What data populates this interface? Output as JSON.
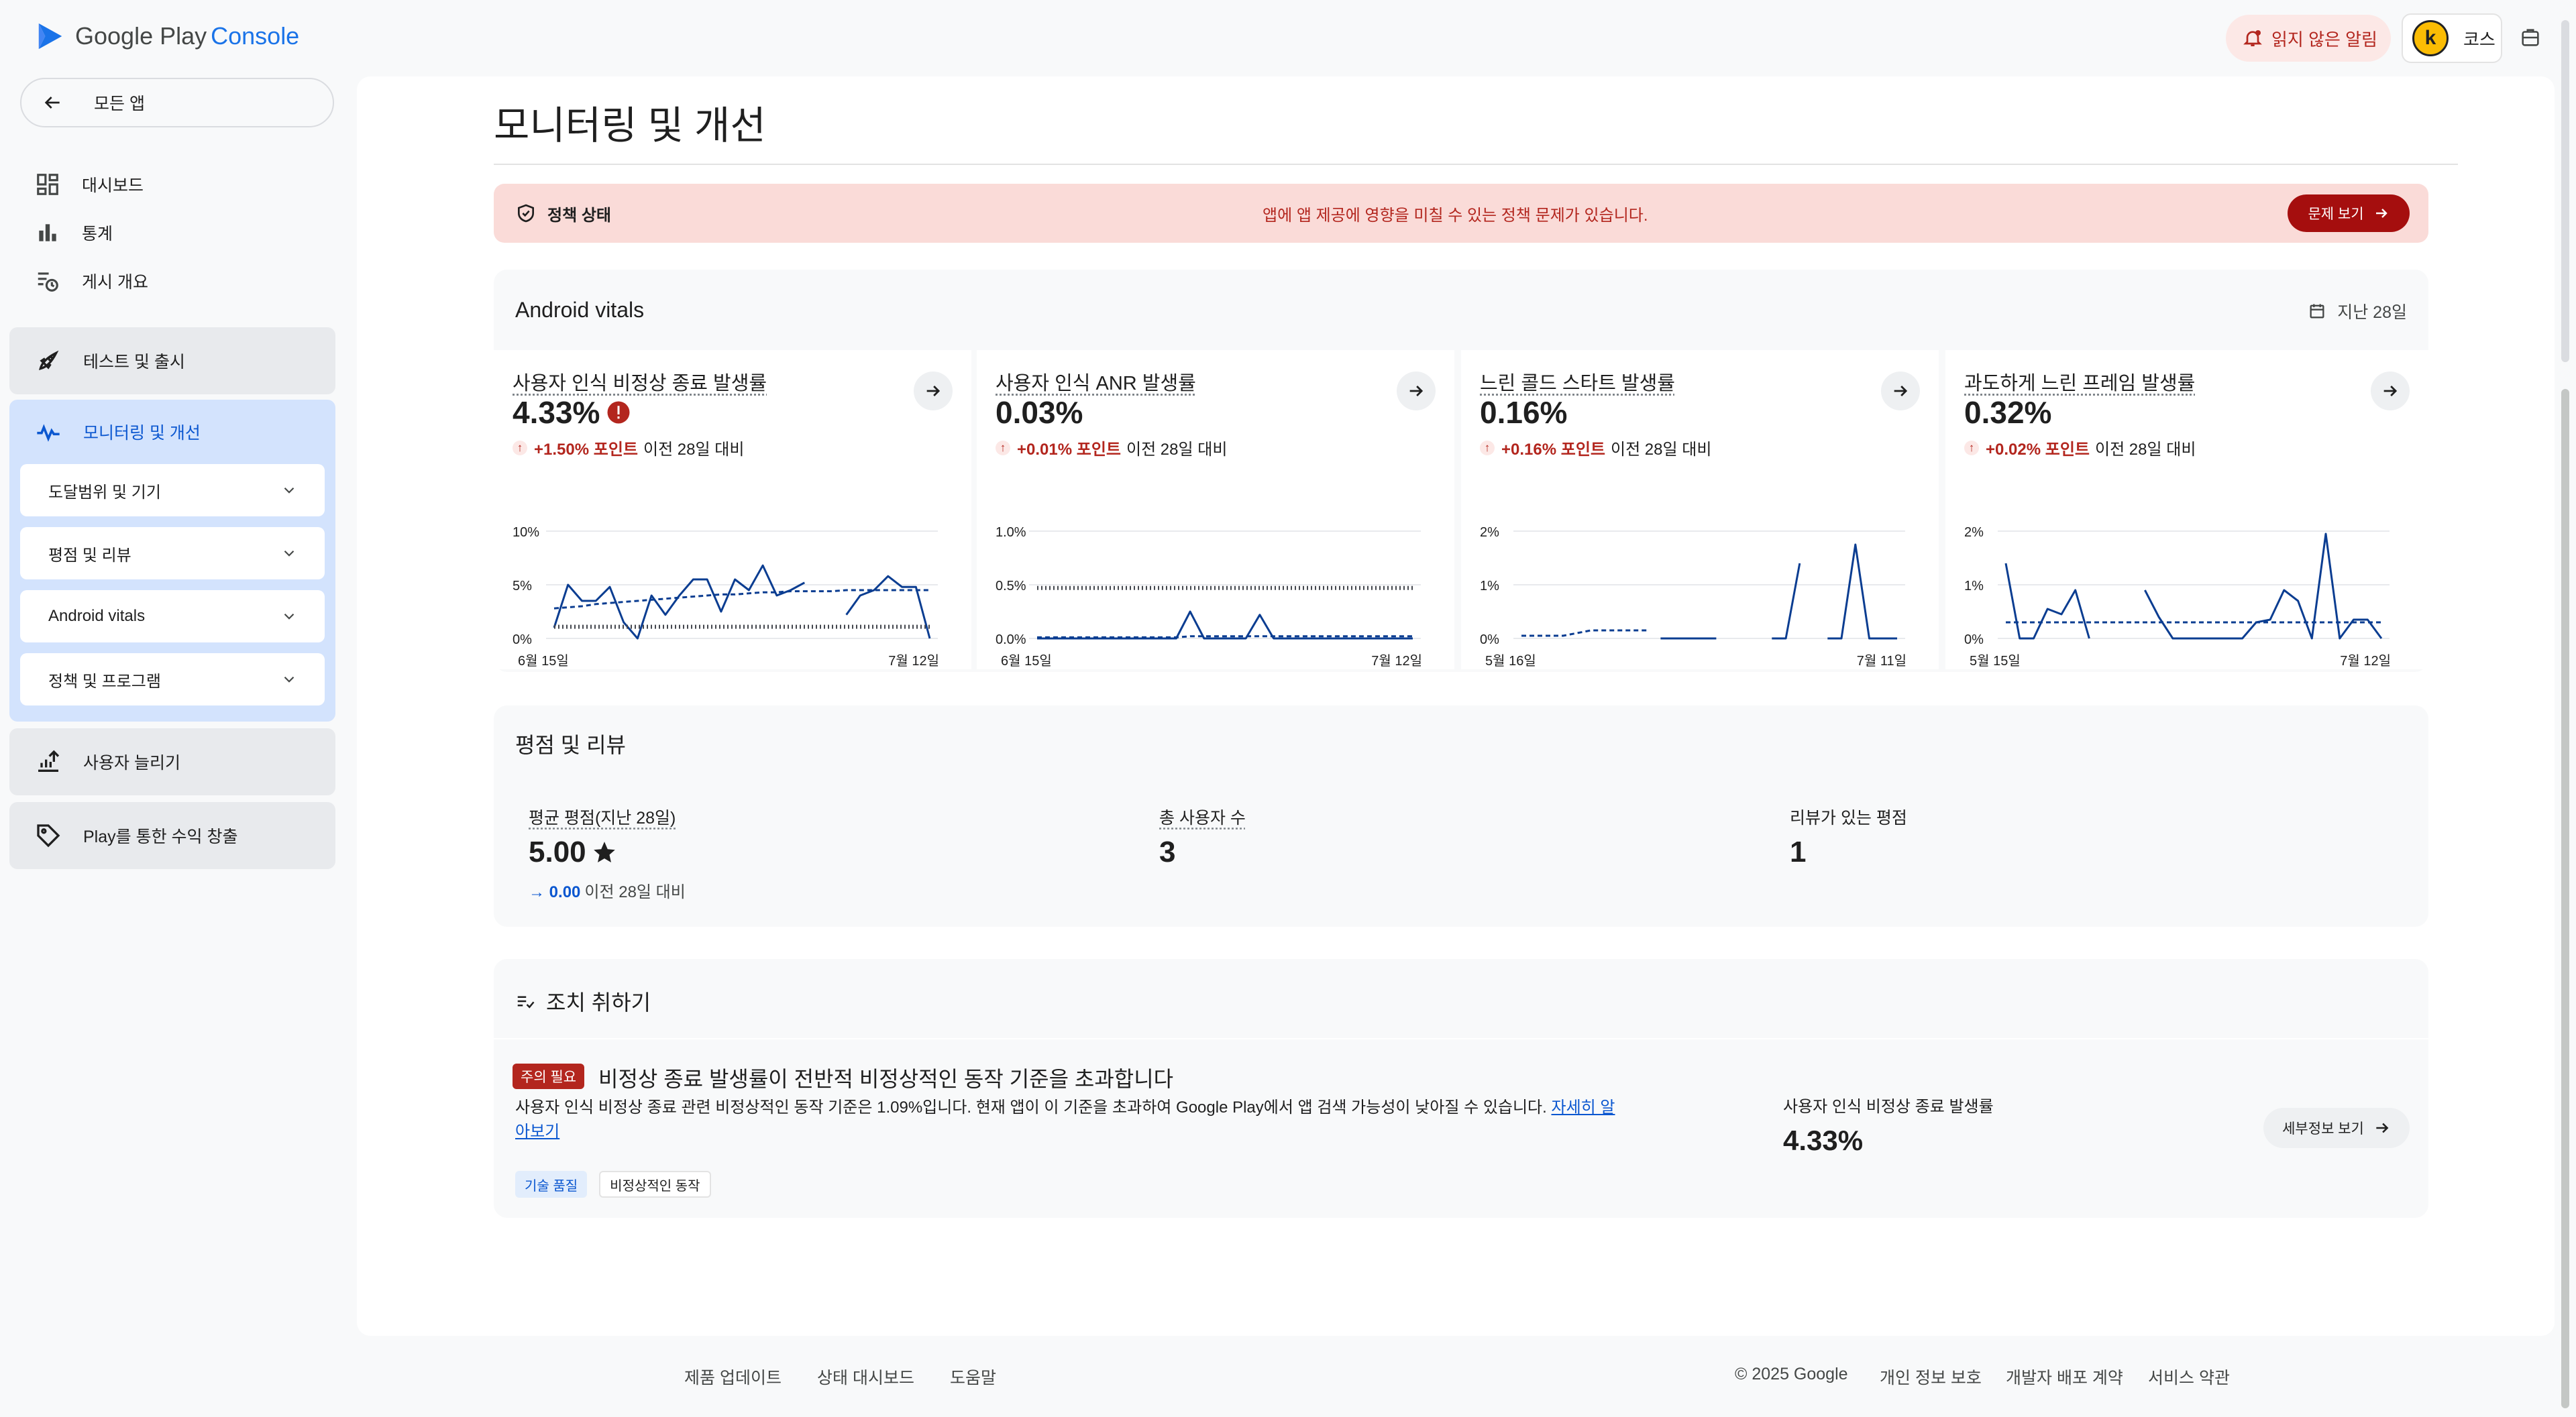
{
  "app": {
    "logo_main": "Google Play",
    "logo_sub": "Console"
  },
  "topbar": {
    "notifications_label": "읽지 않은 알림",
    "account_name": "코스",
    "avatar_letter": "k"
  },
  "sidebar": {
    "back_label": "모든 앱",
    "items": [
      {
        "label": "대시보드",
        "icon": "dashboard-icon"
      },
      {
        "label": "통계",
        "icon": "bar-chart-icon"
      },
      {
        "label": "게시 개요",
        "icon": "publishing-overview-icon"
      }
    ],
    "sections": {
      "test_release": "테스트 및 출시",
      "monitor": "모니터링 및 개선",
      "grow": "사용자 늘리기",
      "monetize": "Play를 통한 수익 창출"
    },
    "monitor_sub": [
      "도달범위 및 기기",
      "평점 및 리뷰",
      "Android vitals",
      "정책 및 프로그램"
    ]
  },
  "page": {
    "title": "모니터링 및 개선"
  },
  "policy": {
    "label": "정책 상태",
    "message": "앱에 앱 제공에 영향을 미칠 수 있는 정책 문제가 있습니다.",
    "button": "문제 보기"
  },
  "vitals": {
    "title": "Android vitals",
    "period": "지난 28일",
    "compare_label": "이전 28일 대비",
    "tiles": [
      {
        "name": "사용자 인식 비정상 종료 발생률",
        "value": "4.33%",
        "delta": "+1.50% 포인트",
        "warning": true,
        "y_ticks": [
          "10%",
          "5%",
          "0%"
        ],
        "x_start": "6월 15일",
        "x_end": "7월 12일"
      },
      {
        "name": "사용자 인식 ANR 발생률",
        "value": "0.03%",
        "delta": "+0.01% 포인트",
        "warning": false,
        "y_ticks": [
          "1.0%",
          "0.5%",
          "0.0%"
        ],
        "x_start": "6월 15일",
        "x_end": "7월 12일"
      },
      {
        "name": "느린 콜드 스타트 발생률",
        "value": "0.16%",
        "delta": "+0.16% 포인트",
        "warning": false,
        "y_ticks": [
          "2%",
          "1%",
          "0%"
        ],
        "x_start": "5월 16일",
        "x_end": "7월 11일"
      },
      {
        "name": "과도하게 느린 프레임 발생률",
        "value": "0.32%",
        "delta": "+0.02% 포인트",
        "warning": false,
        "y_ticks": [
          "2%",
          "1%",
          "0%"
        ],
        "x_start": "5월 15일",
        "x_end": "7월 12일"
      }
    ]
  },
  "ratings": {
    "title": "평점 및 리뷰",
    "avg_label": "평균 평점(지난 28일)",
    "avg_value": "5.00",
    "avg_delta": "0.00",
    "avg_delta_suffix": "이전 28일 대비",
    "users_label": "총 사용자 수",
    "users_value": "3",
    "reviews_label": "리뷰가 있는 평점",
    "reviews_value": "1"
  },
  "actions": {
    "title": "조치 취하기",
    "badge": "주의 필요",
    "item_title": "비정상 종료 발생률이 전반적 비정상적인 동작 기준을 초과합니다",
    "item_desc": "사용자 인식 비정상 종료 관련 비정상적인 동작 기준은 1.09%입니다. 현재 앱이 이 기준을 초과하여 Google Play에서 앱 검색 가능성이 낮아질 수 있습니다. ",
    "learn_more": "자세히 알아보기",
    "chips": [
      "기술 품질",
      "비정상적인 동작"
    ],
    "metric_label": "사용자 인식 비정상 종료 발생률",
    "metric_value": "4.33%",
    "detail_button": "세부정보 보기"
  },
  "footer": {
    "left": [
      "제품 업데이트",
      "상태 대시보드",
      "도움말"
    ],
    "copyright": "© 2025 Google",
    "right": [
      "개인 정보 보호",
      "개발자 배포 계약",
      "서비스 약관"
    ]
  },
  "colors": {
    "accent": "#0b57d0",
    "error": "#b3261e",
    "chart_line": "#0b3d91"
  },
  "chart_data": [
    {
      "type": "line",
      "title": "사용자 인식 비정상 종료 발생률",
      "ylim": [
        0,
        10
      ],
      "series": [
        {
          "values": [
            1,
            5,
            3.5,
            3.5,
            4.8,
            1.5,
            0,
            4,
            2.2,
            4,
            5.5,
            5.5,
            2.5,
            5.5,
            4.5,
            6.8,
            4,
            4.5,
            5.2,
            null,
            null,
            2.2,
            4,
            4.5,
            5.8,
            4.8,
            4.8,
            0
          ]
        },
        {
          "values": [
            2.8,
            2.9,
            3,
            3.2,
            3.3,
            3.4,
            3.5,
            3.6,
            3.7,
            3.8,
            3.9,
            4,
            4.1,
            4.1,
            4.2,
            4.3,
            4.3,
            4.4,
            4.4,
            4.4,
            4.4,
            4.5,
            4.5,
            4.5,
            4.5,
            4.5,
            4.5,
            4.5
          ]
        },
        {
          "values": [
            1.09,
            1.09,
            1.09,
            1.09,
            1.09,
            1.09,
            1.09,
            1.09,
            1.09,
            1.09,
            1.09,
            1.09,
            1.09,
            1.09,
            1.09,
            1.09,
            1.09,
            1.09,
            1.09,
            1.09,
            1.09,
            1.09,
            1.09,
            1.09,
            1.09,
            1.09,
            1.09,
            1.09
          ]
        }
      ]
    },
    {
      "type": "line",
      "title": "사용자 인식 ANR 발생률",
      "ylim": [
        0,
        1
      ],
      "series": [
        {
          "values": [
            0,
            0,
            0,
            0,
            0,
            0,
            0,
            0,
            0,
            0,
            0,
            0.25,
            0,
            0,
            0,
            0,
            0.22,
            0,
            0,
            0,
            0,
            0,
            0,
            0,
            0,
            0,
            0,
            0
          ]
        },
        {
          "values": [
            0.01,
            0.01,
            0.01,
            0.01,
            0.01,
            0.01,
            0.01,
            0.01,
            0.01,
            0.01,
            0.01,
            0.02,
            0.02,
            0.02,
            0.02,
            0.02,
            0.02,
            0.02,
            0.02,
            0.02,
            0.02,
            0.02,
            0.02,
            0.02,
            0.02,
            0.02,
            0.02,
            0.02
          ]
        },
        {
          "values": [
            0.47,
            0.47,
            0.47,
            0.47,
            0.47,
            0.47,
            0.47,
            0.47,
            0.47,
            0.47,
            0.47,
            0.47,
            0.47,
            0.47,
            0.47,
            0.47,
            0.47,
            0.47,
            0.47,
            0.47,
            0.47,
            0.47,
            0.47,
            0.47,
            0.47,
            0.47,
            0.47,
            0.47
          ]
        }
      ]
    },
    {
      "type": "line",
      "title": "느린 콜드 스타트 발생률",
      "ylim": [
        0,
        2
      ],
      "series": [
        {
          "values": [
            null,
            null,
            null,
            null,
            null,
            null,
            null,
            null,
            null,
            null,
            0,
            0,
            0,
            0,
            0,
            null,
            null,
            null,
            0,
            0,
            1.4,
            null,
            0,
            0,
            1.75,
            0,
            0,
            0
          ]
        },
        {
          "values": [
            0.05,
            0.05,
            0.05,
            0.05,
            0.1,
            0.15,
            0.15,
            0.15,
            0.15,
            0.15,
            null,
            null,
            null,
            null,
            null,
            null,
            null,
            null,
            null,
            null,
            null,
            null,
            null,
            null,
            null,
            null,
            null,
            null
          ]
        }
      ]
    },
    {
      "type": "line",
      "title": "과도하게 느린 프레임 발생률",
      "ylim": [
        0,
        2
      ],
      "series": [
        {
          "values": [
            1.4,
            0,
            0,
            0.55,
            0.45,
            0.9,
            0,
            null,
            null,
            null,
            0.9,
            0.4,
            0,
            0,
            0,
            0,
            0,
            0,
            0.3,
            0.35,
            0.9,
            0.7,
            0,
            1.95,
            0,
            0.35,
            0.35,
            0
          ]
        },
        {
          "values": [
            0.3,
            0.3,
            0.3,
            0.3,
            0.3,
            0.3,
            0.3,
            0.3,
            0.3,
            0.3,
            0.3,
            0.3,
            0.3,
            0.3,
            0.3,
            0.3,
            0.3,
            0.3,
            0.3,
            0.3,
            0.3,
            0.3,
            0.3,
            0.3,
            0.3,
            0.3,
            0.3,
            0.3
          ]
        }
      ]
    }
  ]
}
